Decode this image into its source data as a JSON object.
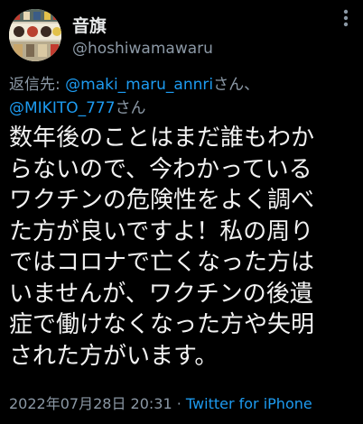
{
  "user": {
    "display_name": "音旗",
    "handle": "@hoshiwamawaru",
    "avatar_icon": "avatar-image"
  },
  "reply": {
    "prefix": "返信先: ",
    "mention_1": "@maki_maru_annri",
    "suffix_1": "さん、",
    "mention_2": "@MIKITO_777",
    "suffix_2": "さん"
  },
  "tweet": {
    "lines": [
      "数年後のことはまだ誰もわか",
      "らないので、今わかっている",
      "ワクチンの危険性をよく調べ",
      "た方が良いですよ！私の周り",
      "ではコロナで亡くなった方は",
      "いませんが、ワクチンの後遺",
      "症で働けなくなった方や失明",
      "された方がいます。"
    ]
  },
  "meta": {
    "timestamp": "2022年07月28日 20:31",
    "separator": " · ",
    "source": "Twitter for iPhone"
  },
  "colors": {
    "background": "#000000",
    "text": "#e7e9ea",
    "secondary": "#8b98a5",
    "link": "#1d9bf0"
  }
}
